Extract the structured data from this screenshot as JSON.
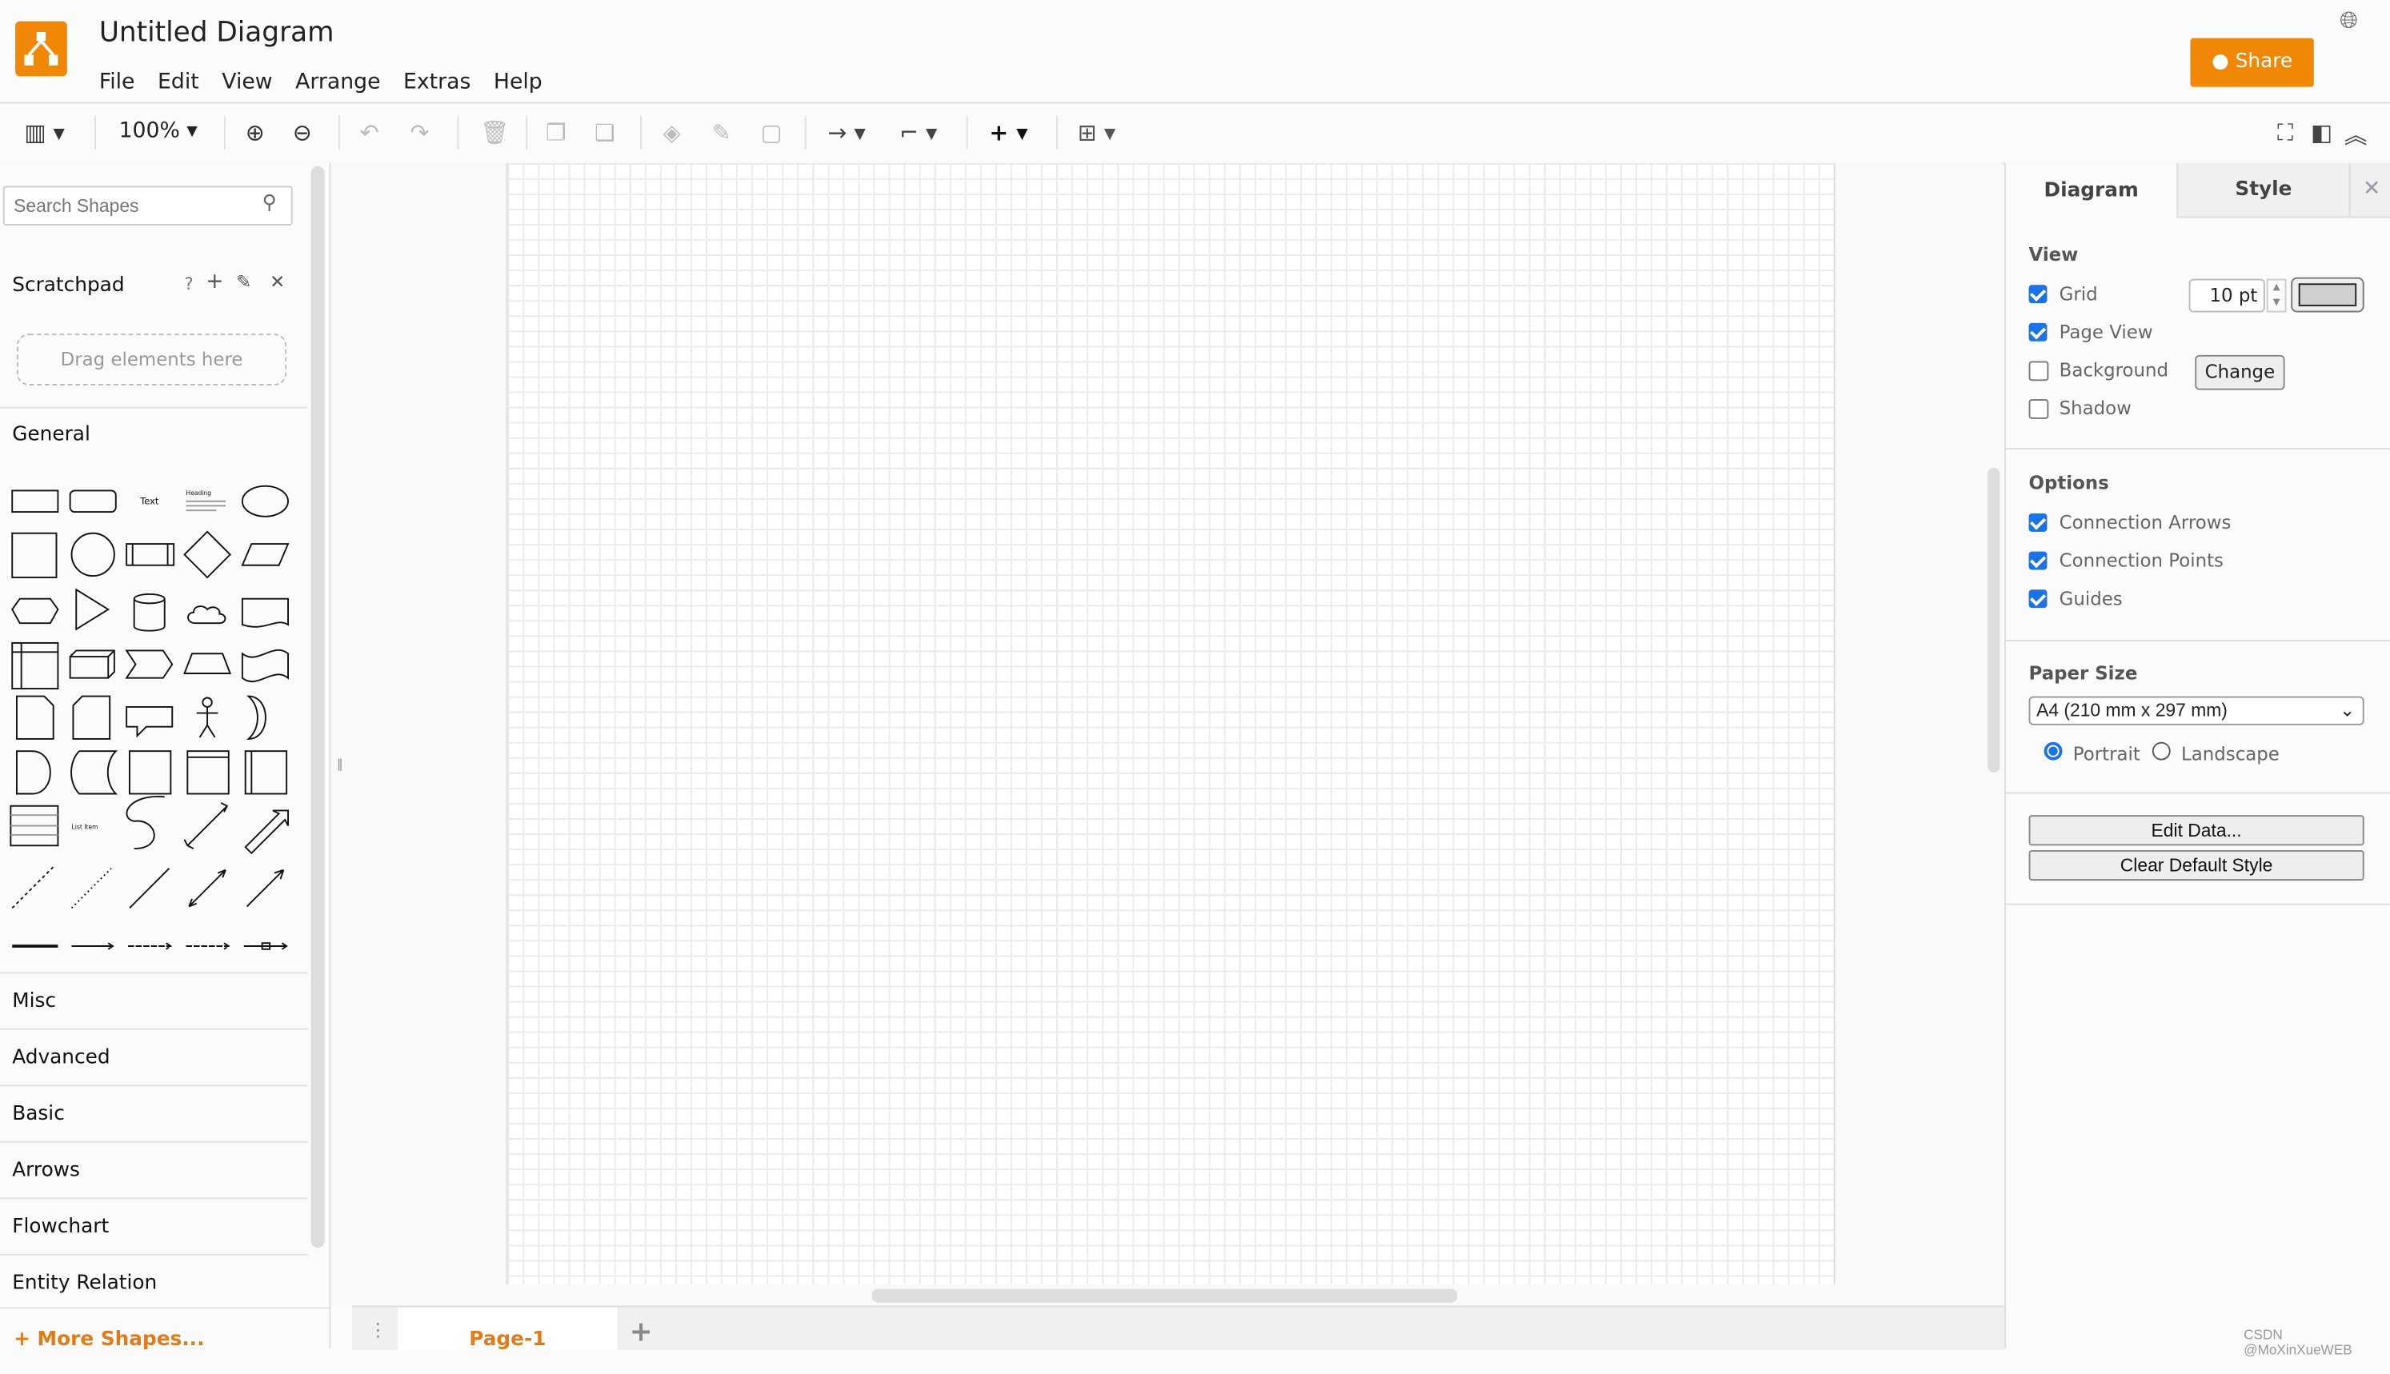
{
  "app": {
    "title": "Untitled Diagram",
    "logo": "drawio-logo",
    "share_label": "Share",
    "globe_icon": "globe-icon",
    "accent": "#f08705"
  },
  "menu": [
    "File",
    "Edit",
    "View",
    "Arrange",
    "Extras",
    "Help"
  ],
  "toolbar": {
    "zoom": "100%",
    "icons": [
      "format-panel-icon",
      "zoom-in-icon",
      "zoom-out-icon",
      "undo-icon",
      "redo-icon",
      "delete-icon",
      "to-front-icon",
      "to-back-icon",
      "fill-color-icon",
      "line-color-icon",
      "shadow-icon",
      "connection-icon",
      "waypoints-icon",
      "insert-icon",
      "table-icon",
      "fullscreen-icon",
      "format-toggle-icon",
      "collapse-icon"
    ]
  },
  "sidebar": {
    "search_placeholder": "Search Shapes",
    "scratchpad": "Scratchpad",
    "scratchpad_actions": [
      "?",
      "+"
    ],
    "drag_hint": "Drag elements here",
    "general": "General",
    "palette_text": "Text",
    "palette_heading": "Heading",
    "palette_listitem": "List Item",
    "sections": [
      "Misc",
      "Advanced",
      "Basic",
      "Arrows",
      "Flowchart",
      "Entity Relation"
    ],
    "more_shapes": "More Shapes..."
  },
  "pages": {
    "tabs": [
      "Page-1"
    ]
  },
  "panel": {
    "tabs": [
      "Diagram",
      "Style"
    ],
    "view_title": "View",
    "view": [
      {
        "label": "Grid",
        "checked": true
      },
      {
        "label": "Page View",
        "checked": true
      },
      {
        "label": "Background",
        "checked": false
      },
      {
        "label": "Shadow",
        "checked": false
      }
    ],
    "grid_size": "10 pt",
    "grid_color": "#d0d0d0",
    "change_label": "Change",
    "options_title": "Options",
    "options": [
      {
        "label": "Connection Arrows",
        "checked": true
      },
      {
        "label": "Connection Points",
        "checked": true
      },
      {
        "label": "Guides",
        "checked": true
      }
    ],
    "paper_title": "Paper Size",
    "paper_size": "A4 (210 mm x 297 mm)",
    "portrait": "Portrait",
    "landscape": "Landscape",
    "orientation": "portrait",
    "edit_data": "Edit Data...",
    "clear_style": "Clear Default Style"
  },
  "watermark": "CSDN @MoXinXueWEB"
}
